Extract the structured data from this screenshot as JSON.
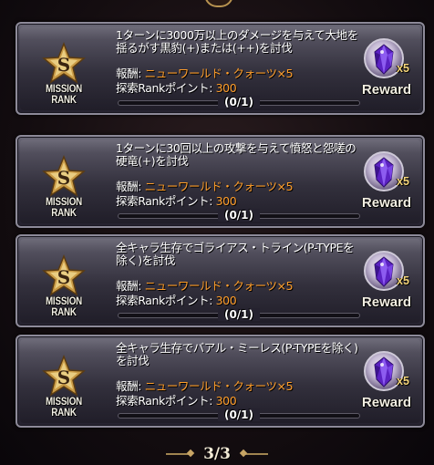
{
  "missions": [
    {
      "rank_label": "MISSION RANK",
      "rank_letter": "S",
      "description": "1ターンに3000万以上のダメージを与えて大地を揺るがす黒豹(+)または(++)を討伐",
      "reward_prefix": "報酬: ",
      "reward_value": "ニューワールド・クォーツ×5",
      "points_prefix": "探索Rankポイント: ",
      "points_value": "300",
      "progress": "(0/1)",
      "progress_fraction": 0,
      "reward_qty": "x5",
      "reward_label": "Reward",
      "reward_icon": "crystal-icon"
    },
    {
      "rank_label": "MISSION RANK",
      "rank_letter": "S",
      "description": "1ターンに30回以上の攻撃を与えて憤怒と怨嗟の硬竜(+)を討伐",
      "reward_prefix": "報酬: ",
      "reward_value": "ニューワールド・クォーツ×5",
      "points_prefix": "探索Rankポイント: ",
      "points_value": "300",
      "progress": "(0/1)",
      "progress_fraction": 0,
      "reward_qty": "x5",
      "reward_label": "Reward",
      "reward_icon": "crystal-icon"
    },
    {
      "rank_label": "MISSION RANK",
      "rank_letter": "S",
      "description": "全キャラ生存でゴライアス・トライン(P-TYPEを除く)を討伐",
      "reward_prefix": "報酬: ",
      "reward_value": "ニューワールド・クォーツ×5",
      "points_prefix": "探索Rankポイント: ",
      "points_value": "300",
      "progress": "(0/1)",
      "progress_fraction": 0,
      "reward_qty": "x5",
      "reward_label": "Reward",
      "reward_icon": "crystal-icon"
    },
    {
      "rank_label": "MISSION RANK",
      "rank_letter": "S",
      "description": "全キャラ生存でバアル・ミーレス(P-TYPEを除く)を討伐",
      "reward_prefix": "報酬: ",
      "reward_value": "ニューワールド・クォーツ×5",
      "points_prefix": "探索Rankポイント: ",
      "points_value": "300",
      "progress": "(0/1)",
      "progress_fraction": 0,
      "reward_qty": "x5",
      "reward_label": "Reward",
      "reward_icon": "crystal-icon"
    }
  ],
  "pager": {
    "text": "3/3"
  },
  "colors": {
    "accent": "#ff9e2a",
    "badge_gold": "#d9b060",
    "crystal": "#6a2fd0"
  }
}
